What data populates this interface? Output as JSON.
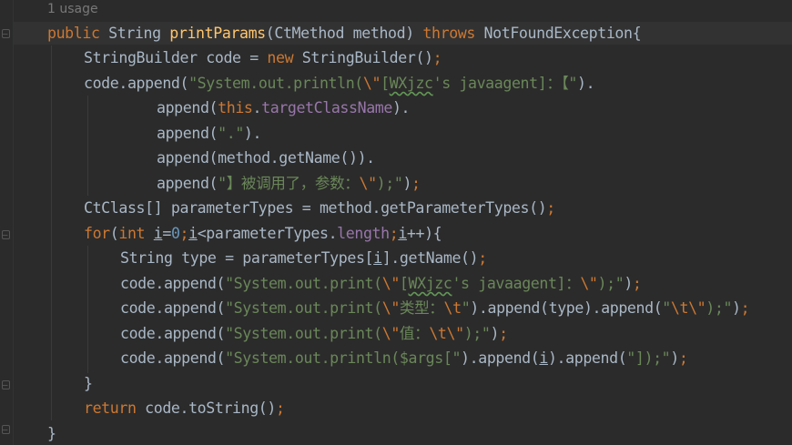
{
  "usage_hint": "1 usage",
  "code": {
    "l1": {
      "public": "public",
      "type": " String ",
      "name": "printParams",
      "args": "(CtMethod method) ",
      "throws": "throws",
      "exc": " NotFoundException{"
    },
    "l2": {
      "a": "StringBuilder code = ",
      "new": "new",
      "b": " StringBuilder()",
      "semi": ";"
    },
    "l3": {
      "a": "code.append(",
      "s1": "\"System.out.println(",
      "e1": "\\\"",
      "s2": "[",
      "w": "WXjzc",
      "s3": "'s javaagent]：【",
      "s4": "\"",
      "b": ")."
    },
    "l4": {
      "a": "append(",
      "this": "this",
      "dot": ".",
      "fld": "targetClassName",
      "b": ")."
    },
    "l5": {
      "a": "append(",
      "s": "\".\"",
      "b": ")."
    },
    "l6": {
      "a": "append(method.getName())."
    },
    "l7": {
      "a": "append(",
      "s1": "\"】被调用了，参数：",
      "e1": "\\\"",
      "s2": ");\"",
      "b": ")",
      "semi": ";"
    },
    "l8": {
      "a": "CtClass[] parameterTypes = method.getParameterTypes()",
      "semi": ";"
    },
    "l9": {
      "for": "for",
      "a": "(",
      "int": "int",
      "sp": " ",
      "i1": "i",
      "eq": "=",
      "n0": "0",
      "s1": ";",
      "i2": "i",
      "b": "<parameterTypes.",
      "len": "length",
      "s2": ";",
      "i3": "i",
      "c": "++){"
    },
    "l10": {
      "a": "String type = parameterTypes[",
      "i": "i",
      "b": "].getName()",
      "semi": ";"
    },
    "l11": {
      "a": "code.append(",
      "s1": "\"System.out.print(",
      "e1": "\\\"",
      "s2": "[",
      "w": "WXjzc",
      "s3": "'s javaagent]：",
      "e2": "\\\"",
      "s4": ");\"",
      "b": ")",
      "semi": ";"
    },
    "l12": {
      "a": "code.append(",
      "s1": "\"System.out.print(",
      "e1": "\\\"",
      "s2": "类型：",
      "e2": "\\t",
      "s3": "\"",
      "b": ").append(type).append(",
      "s4": "\"",
      "e3": "\\t",
      "e4": "\\\"",
      "s5": ");\"",
      "c": ")",
      "semi": ";"
    },
    "l13": {
      "a": "code.append(",
      "s1": "\"System.out.print(",
      "e1": "\\\"",
      "s2": "值：",
      "e2": "\\t",
      "e3": "\\\"",
      "s3": ");\"",
      "b": ")",
      "semi": ";"
    },
    "l14": {
      "a": "code.append(",
      "s1": "\"System.out.println($args[\"",
      "b": ").append(",
      "i": "i",
      "c": ").append(",
      "s2": "\"]);\"",
      "d": ")",
      "semi": ";"
    },
    "l15": {
      "a": "}"
    },
    "l16": {
      "ret": "return",
      "a": " code.toString()",
      "semi": ";"
    },
    "l17": {
      "a": "}"
    }
  },
  "colors": {
    "background": "#2b2b2b",
    "keyword": "#cc7832",
    "function": "#ffc66d",
    "string": "#6a8759",
    "field": "#9876aa",
    "number": "#6897bb",
    "text": "#a9b7c6"
  }
}
